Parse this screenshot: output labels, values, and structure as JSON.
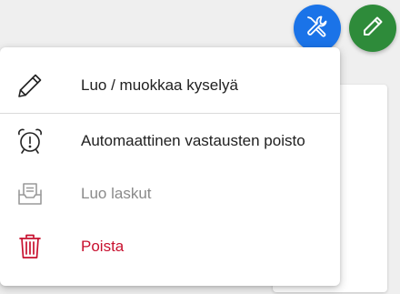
{
  "fabs": {
    "tools": {
      "icon": "tools-icon",
      "color": "#1a73e8"
    },
    "edit": {
      "icon": "pencil-icon",
      "color": "#2e8b3a"
    }
  },
  "menu": {
    "items": [
      {
        "label": "Luo / muokkaa kyselyä",
        "icon": "pencil-icon",
        "state": "enabled"
      },
      {
        "label": "Automaattinen vastausten poisto",
        "icon": "alarm-clock-icon",
        "state": "enabled"
      },
      {
        "label": "Luo laskut",
        "icon": "invoice-inbox-icon",
        "state": "disabled"
      },
      {
        "label": "Poista",
        "icon": "trash-icon",
        "state": "danger",
        "color": "#c8102e"
      }
    ]
  }
}
